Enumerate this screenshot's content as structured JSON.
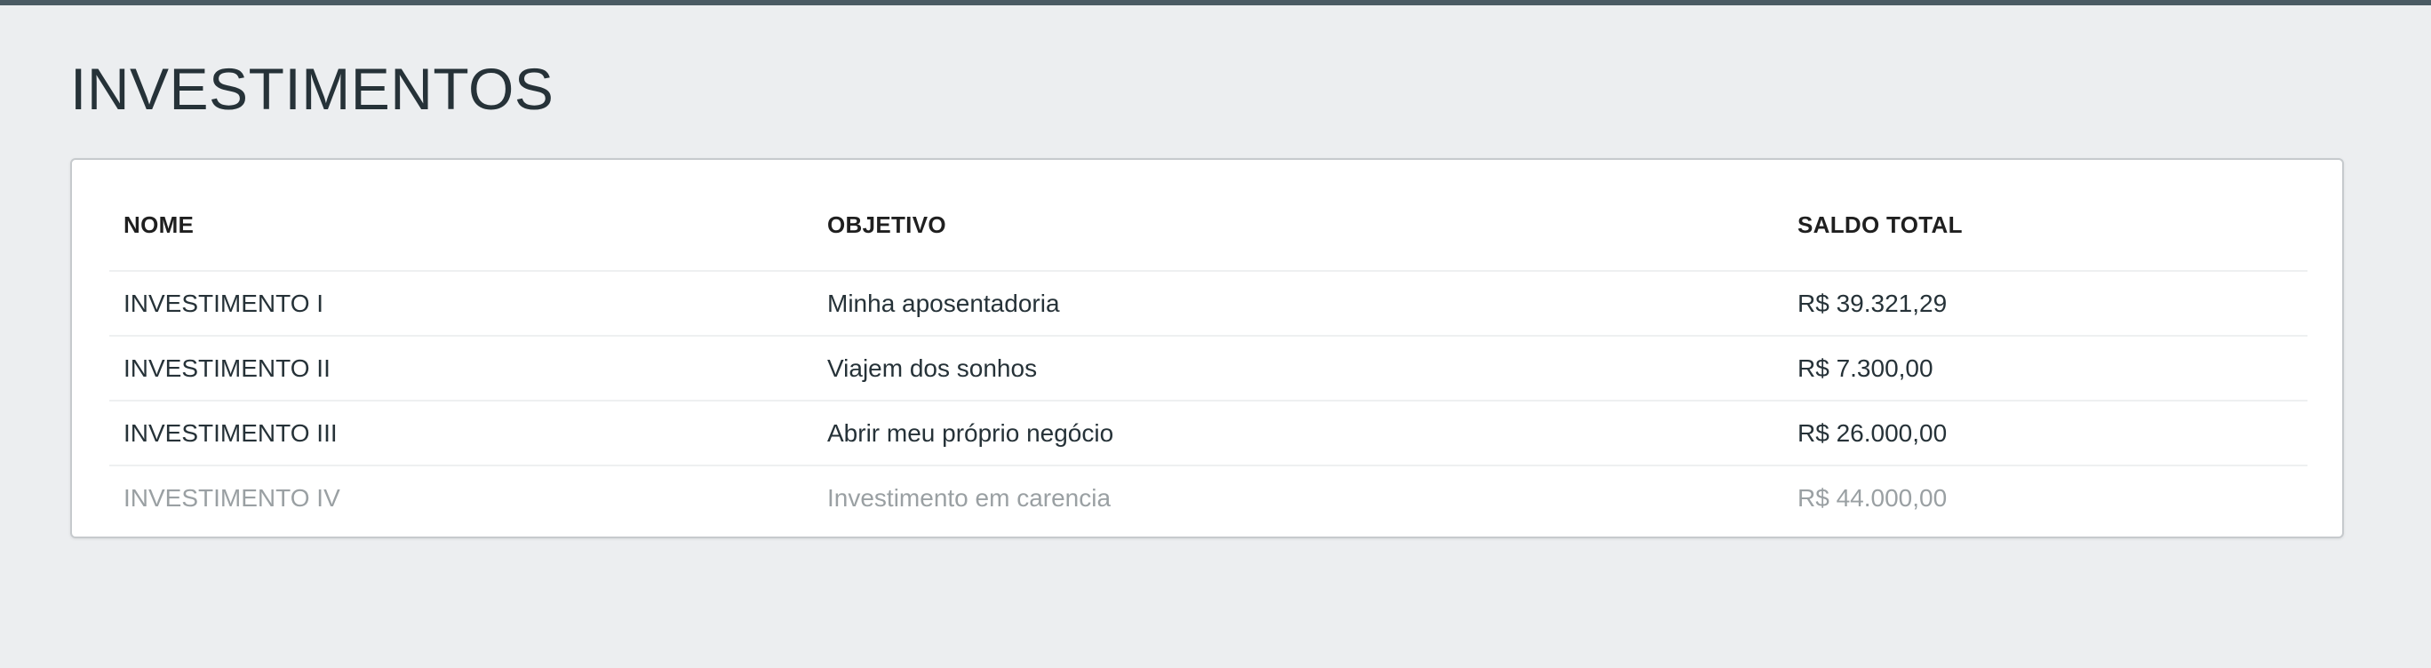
{
  "page": {
    "title": "INVESTIMENTOS"
  },
  "table": {
    "headers": {
      "name": "NOME",
      "goal": "OBJETIVO",
      "balance": "SALDO TOTAL"
    },
    "rows": [
      {
        "name": "INVESTIMENTO I",
        "goal": "Minha aposentadoria",
        "balance": "R$ 39.321,29",
        "state": "active"
      },
      {
        "name": "INVESTIMENTO II",
        "goal": "Viajem dos sonhos",
        "balance": "R$ 7.300,00",
        "state": "active"
      },
      {
        "name": "INVESTIMENTO III",
        "goal": "Abrir meu próprio negócio",
        "balance": "R$ 26.000,00",
        "state": "active"
      },
      {
        "name": "INVESTIMENTO IV",
        "goal": "Investimento em carencia",
        "balance": "R$ 44.000,00",
        "state": "disabled"
      }
    ]
  },
  "colors": {
    "background": "#eceef0",
    "top_bar": "#4a5a63",
    "text": "#263238",
    "muted_text": "#9aa0a3"
  }
}
